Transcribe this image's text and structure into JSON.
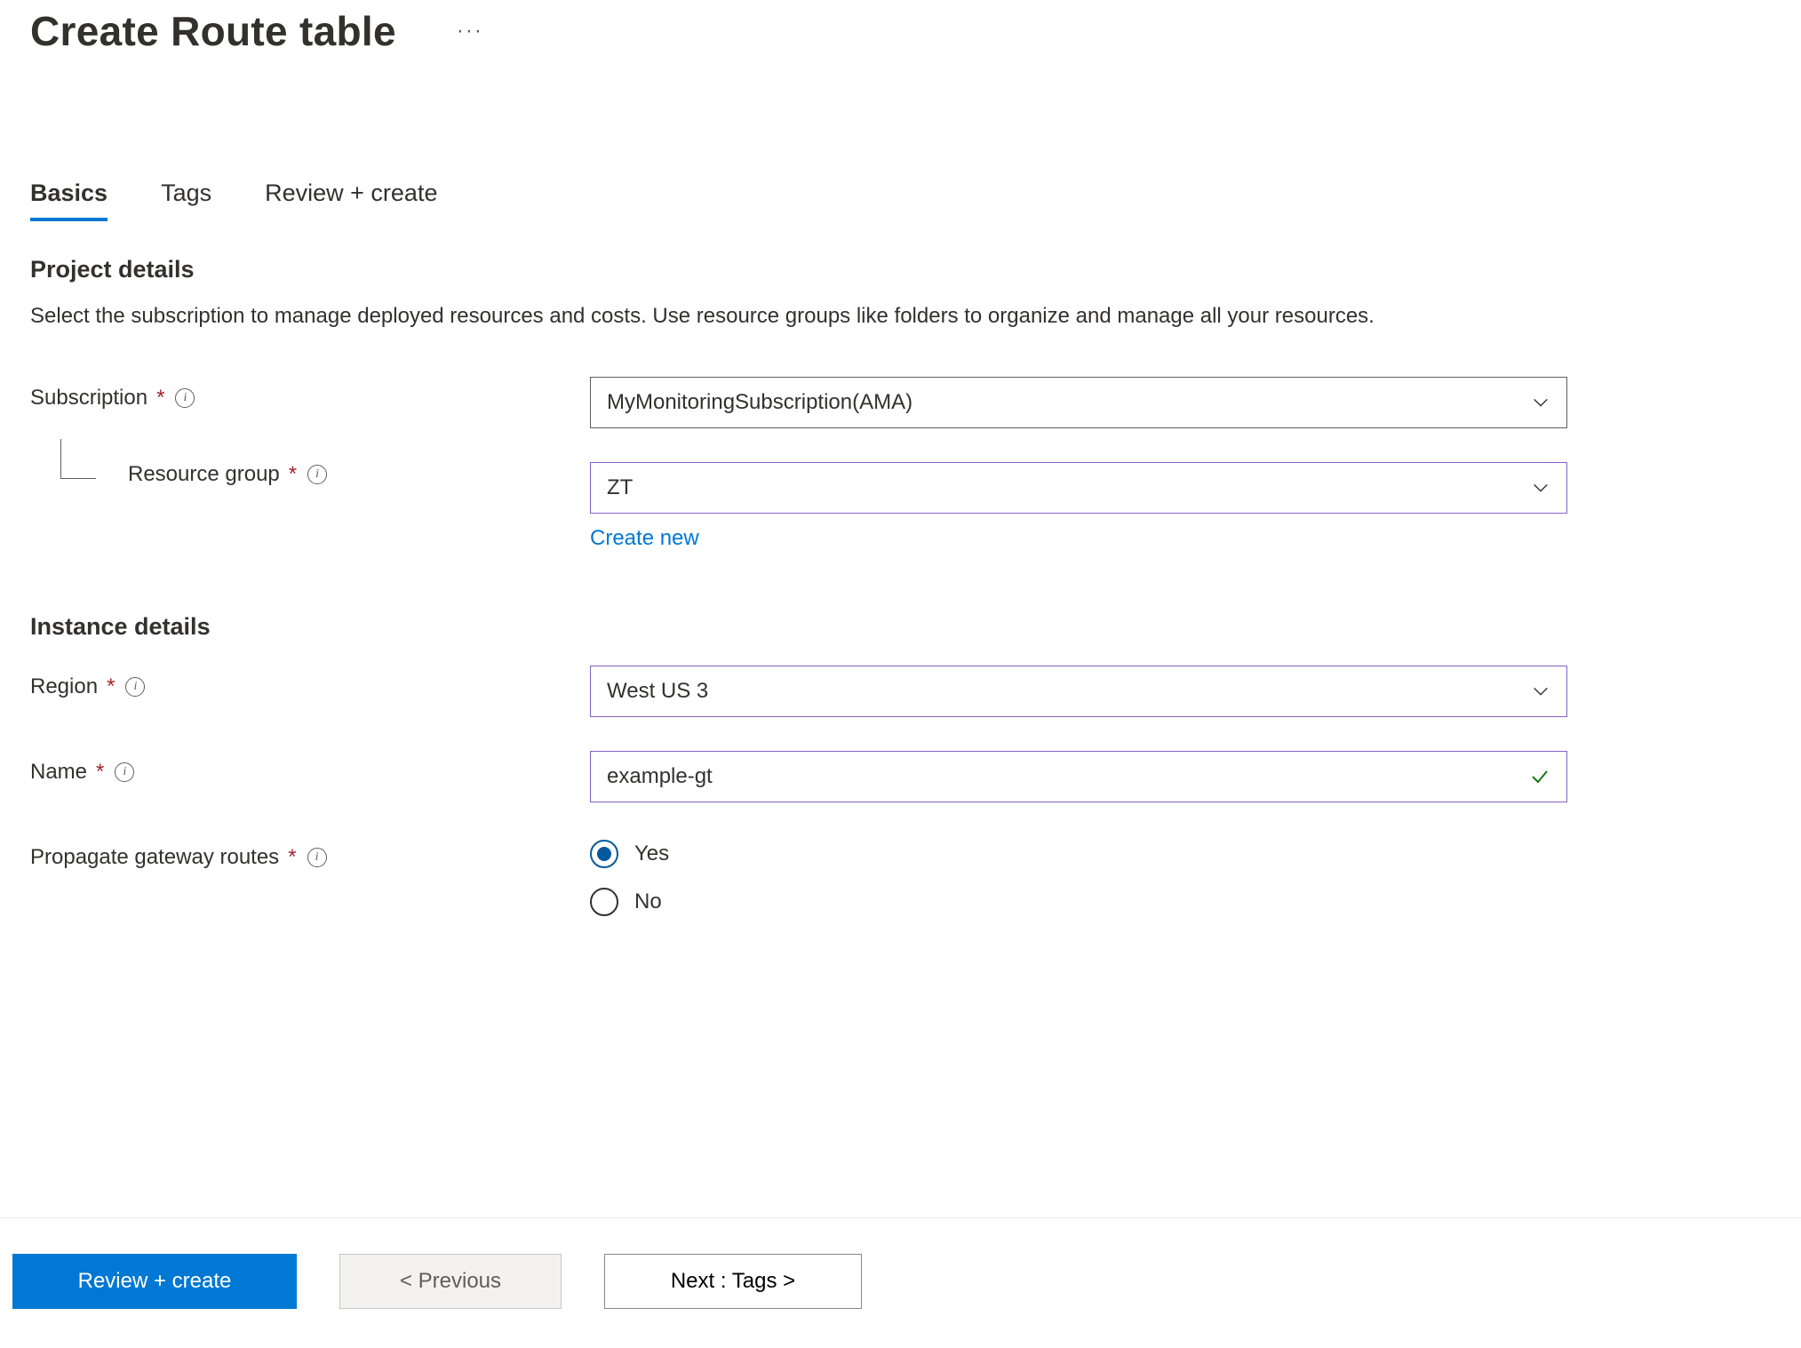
{
  "header": {
    "title": "Create Route table",
    "more_actions": "···"
  },
  "tabs": {
    "items": [
      {
        "label": "Basics",
        "active": true
      },
      {
        "label": "Tags",
        "active": false
      },
      {
        "label": "Review + create",
        "active": false
      }
    ]
  },
  "project_details": {
    "title": "Project details",
    "description": "Select the subscription to manage deployed resources and costs. Use resource groups like folders to organize and manage all your resources.",
    "subscription": {
      "label": "Subscription",
      "value": "MyMonitoringSubscription(AMA)"
    },
    "resource_group": {
      "label": "Resource group",
      "value": "ZT",
      "create_new": "Create new"
    }
  },
  "instance_details": {
    "title": "Instance details",
    "region": {
      "label": "Region",
      "value": "West US 3"
    },
    "name": {
      "label": "Name",
      "value": "example-gt"
    },
    "propagate": {
      "label": "Propagate gateway routes",
      "options": {
        "yes": "Yes",
        "no": "No"
      },
      "selected": "yes"
    }
  },
  "footer": {
    "review_create": "Review + create",
    "previous": "< Previous",
    "next": "Next : Tags >"
  },
  "icons": {
    "info_glyph": "i"
  }
}
